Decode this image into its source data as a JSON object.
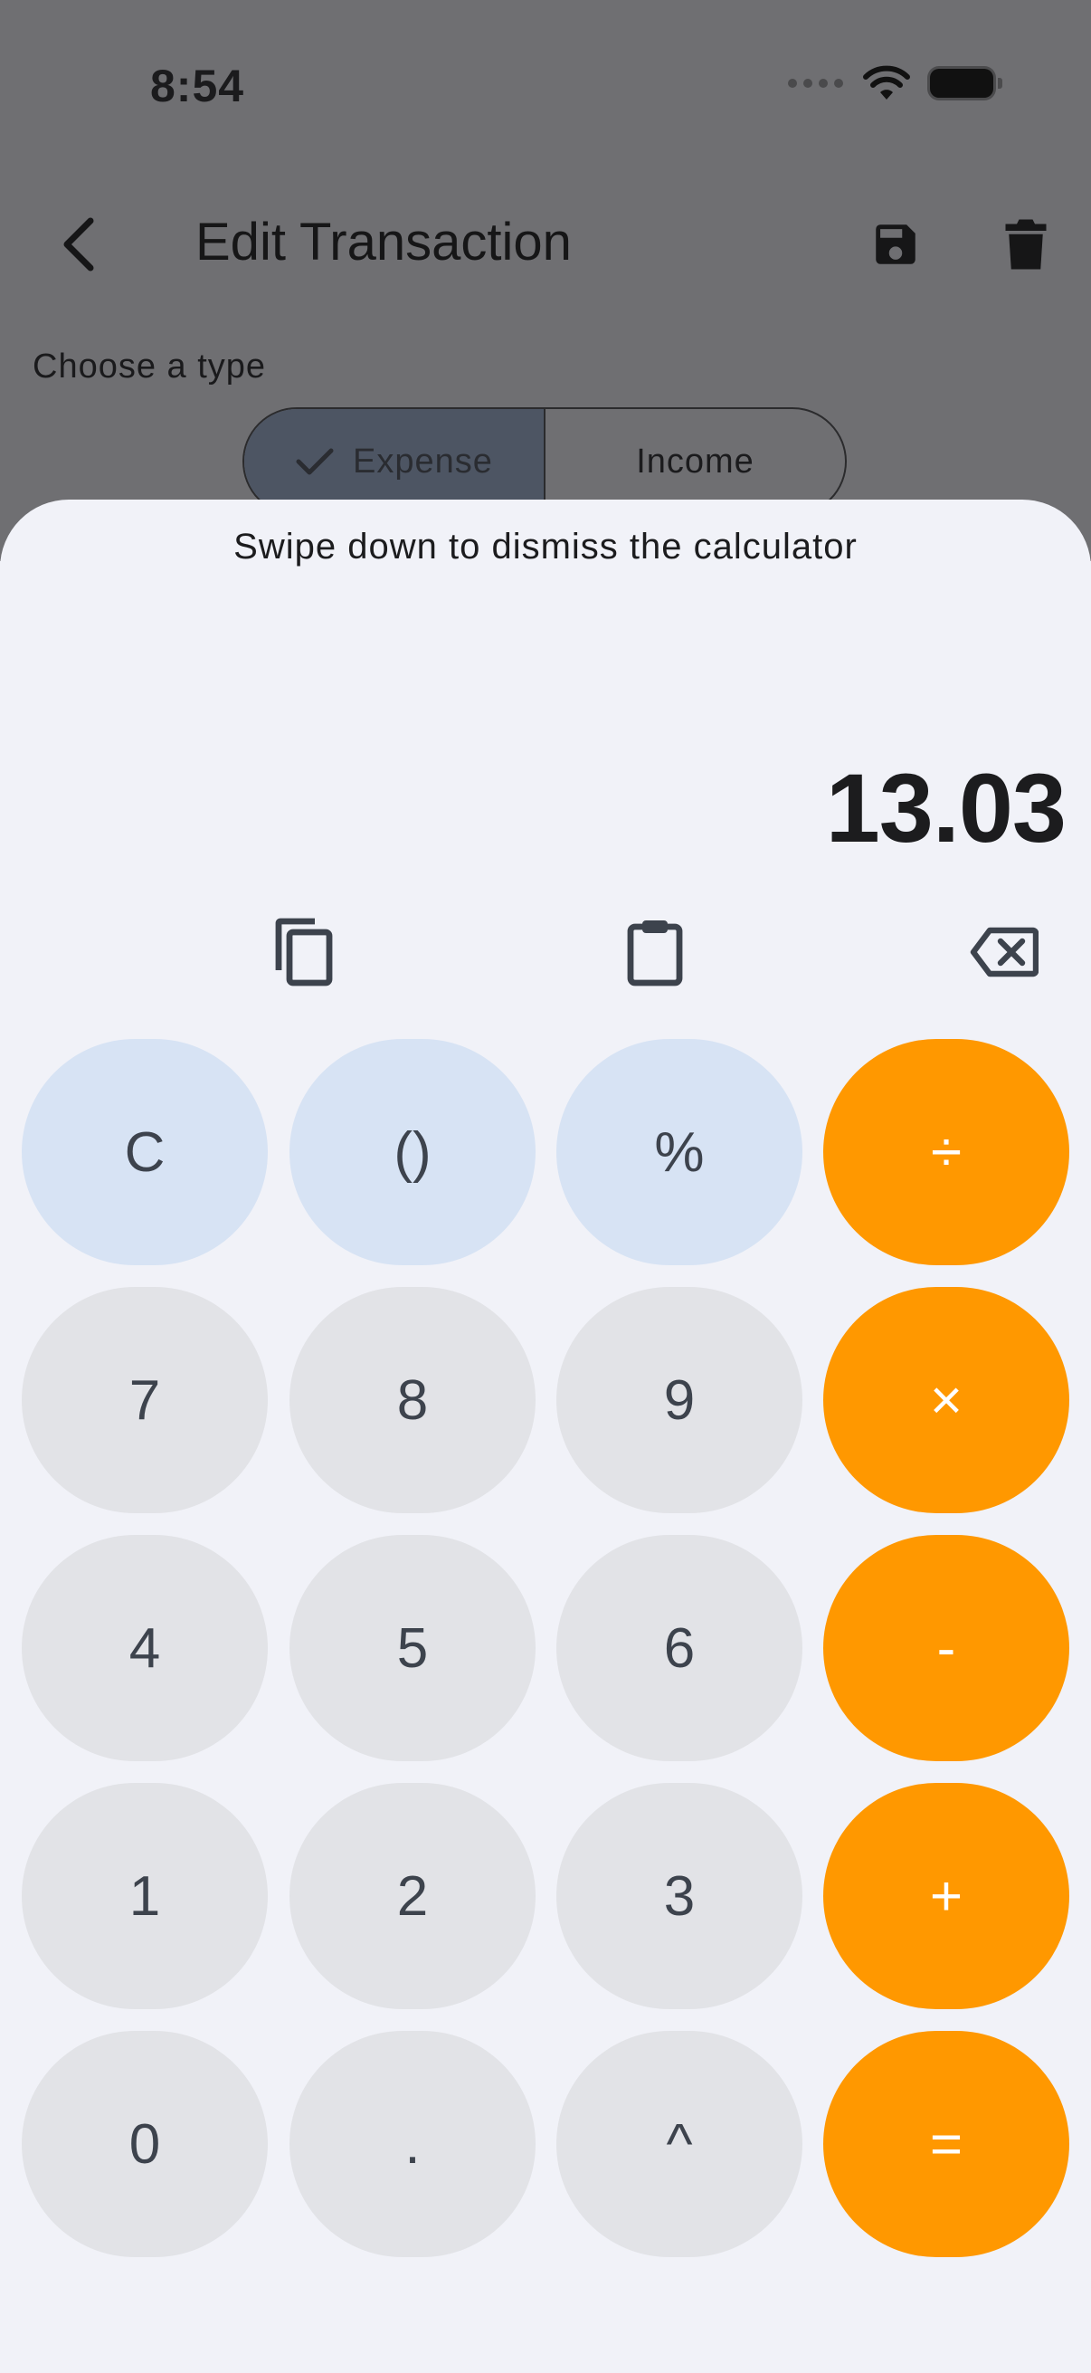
{
  "status_bar": {
    "time": "8:54"
  },
  "app_bar": {
    "title": "Edit Transaction",
    "back_icon": "chevron-left-icon",
    "save_icon": "save-icon",
    "delete_icon": "trash-icon"
  },
  "type_selector": {
    "label": "Choose a type",
    "options": [
      {
        "label": "Expense",
        "selected": true
      },
      {
        "label": "Income",
        "selected": false
      }
    ]
  },
  "calculator": {
    "hint": "Swipe down to dismiss the calculator",
    "display": "13.03",
    "tools": {
      "copy_icon": "copy-icon",
      "paste_icon": "clipboard-icon",
      "backspace_icon": "backspace-icon"
    },
    "keys": [
      [
        "C",
        "()",
        "%",
        "÷"
      ],
      [
        "7",
        "8",
        "9",
        "×"
      ],
      [
        "4",
        "5",
        "6",
        "-"
      ],
      [
        "1",
        "2",
        "3",
        "+"
      ],
      [
        "0",
        ".",
        "^",
        "="
      ]
    ]
  },
  "colors": {
    "operator_key": "#ff9800",
    "function_key": "#d7e3f4",
    "number_key": "#e2e3e7",
    "sheet_background": "#f1f2f8",
    "scrim": "#6f6f72"
  }
}
